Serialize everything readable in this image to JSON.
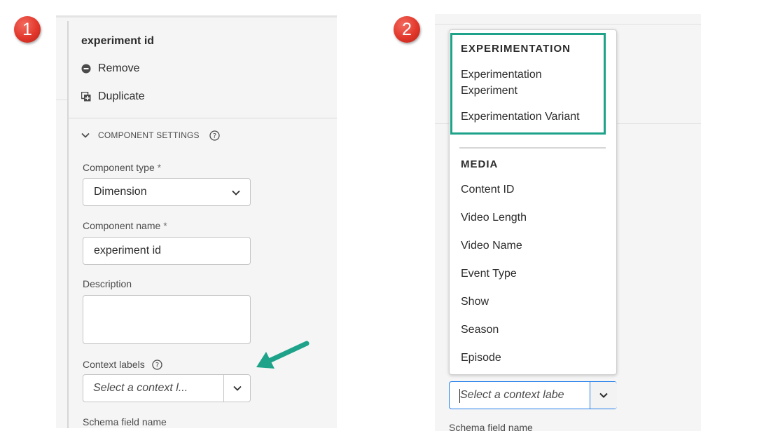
{
  "steps": {
    "one": "1",
    "two": "2"
  },
  "panel1": {
    "heading": "experiment id",
    "remove_label": "Remove",
    "duplicate_label": "Duplicate",
    "section_title": "COMPONENT SETTINGS",
    "component_type": {
      "label": "Component type",
      "required": "*",
      "value": "Dimension"
    },
    "component_name": {
      "label": "Component name",
      "required": "*",
      "value": "experiment id"
    },
    "description": {
      "label": "Description",
      "value": ""
    },
    "context_labels": {
      "label": "Context labels",
      "placeholder": "Select a context l..."
    },
    "schema_field_name_label": "Schema field name"
  },
  "panel2": {
    "groups": [
      {
        "header": "EXPERIMENTATION",
        "items": [
          "Experimentation Experiment",
          "Experimentation Variant"
        ]
      },
      {
        "header": "MEDIA",
        "items": [
          "Content ID",
          "Video Length",
          "Video Name",
          "Event Type",
          "Show",
          "Season",
          "Episode"
        ]
      }
    ],
    "context_placeholder": "Select a context labe",
    "schema_field_name_label": "Schema field name"
  },
  "colors": {
    "highlight": "#1ea38a",
    "arrow": "#1ea38a",
    "badge": "#e2372b",
    "focus_border": "#2680eb",
    "panel_bg": "#f5f5f5"
  }
}
